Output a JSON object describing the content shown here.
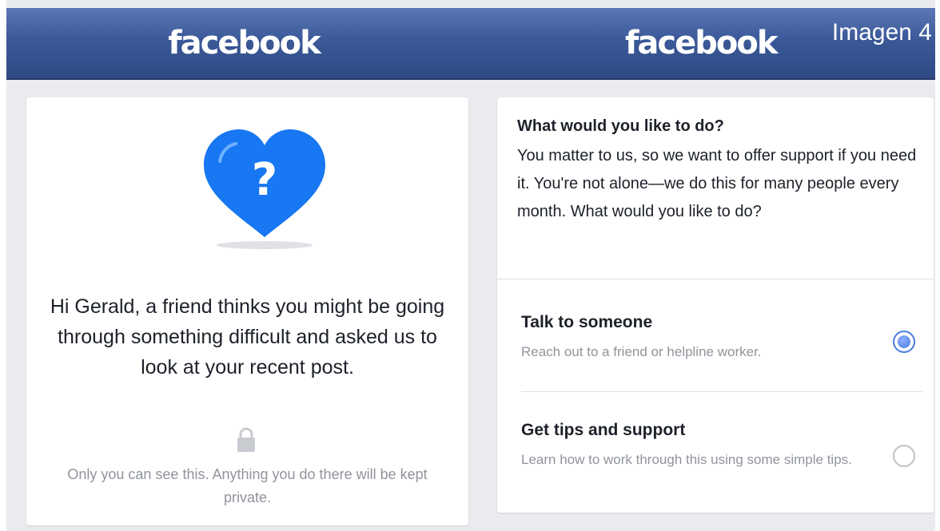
{
  "left": {
    "logo": "facebook",
    "message": "Hi Gerald, a friend thinks you might be going through something difficult and asked us to look at your recent post.",
    "privacy": "Only you can see this. Anything you do there will be kept private."
  },
  "right": {
    "logo": "facebook",
    "overlay_label": "Imagen 4",
    "question_title": "What would you like to do?",
    "question_body": "You matter to us, so we want to offer support if you need it. You're not alone—we do this for many people every month. What would you like to do?",
    "options": [
      {
        "title": "Talk to someone",
        "description": "Reach out to a friend or helpline worker.",
        "selected": true
      },
      {
        "title": "Get tips and support",
        "description": "Learn how to work through this using some simple tips.",
        "selected": false
      }
    ]
  },
  "colors": {
    "brand_bar": "#3b5998",
    "heart": "#1877f2",
    "radio_selected": "#4a7be0"
  },
  "icons": [
    "heart-question-icon",
    "lock-icon"
  ]
}
